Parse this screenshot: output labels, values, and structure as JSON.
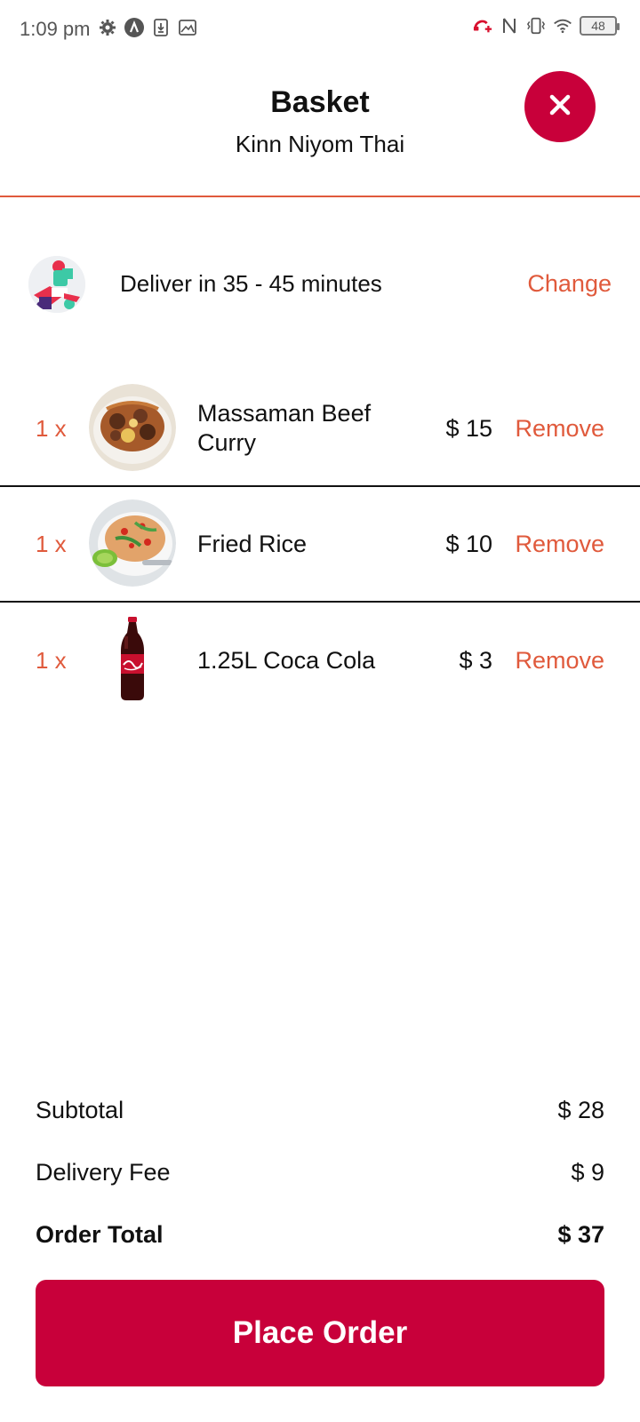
{
  "status_bar": {
    "time": "1:09 pm",
    "battery": "48",
    "left_icons": [
      "gear-icon",
      "assistant-icon",
      "download-icon",
      "image-icon"
    ],
    "right_icons": [
      "call-forward-icon",
      "nfc-icon",
      "vibrate-icon",
      "wifi-icon",
      "battery-icon"
    ]
  },
  "header": {
    "title": "Basket",
    "restaurant": "Kinn Niyom Thai",
    "close_icon": "close-icon"
  },
  "delivery": {
    "text": "Deliver in 35 - 45 minutes",
    "change_label": "Change",
    "icon": "delivery-rider-avatar"
  },
  "items": [
    {
      "qty": "1 x",
      "name": "Massaman Beef Curry",
      "price": "$ 15",
      "remove_label": "Remove",
      "image": "curry-image"
    },
    {
      "qty": "1 x",
      "name": "Fried Rice",
      "price": "$ 10",
      "remove_label": "Remove",
      "image": "fried-rice-image"
    },
    {
      "qty": "1 x",
      "name": "1.25L Coca Cola",
      "price": "$ 3",
      "remove_label": "Remove",
      "image": "coca-cola-bottle-image"
    }
  ],
  "totals": {
    "subtotal_label": "Subtotal",
    "subtotal_value": "$ 28",
    "delivery_fee_label": "Delivery Fee",
    "delivery_fee_value": "$ 9",
    "order_total_label": "Order Total",
    "order_total_value": "$ 37"
  },
  "place_order_label": "Place Order",
  "colors": {
    "accent": "#e05a3c",
    "brand": "#c8003a",
    "text": "#111111"
  }
}
